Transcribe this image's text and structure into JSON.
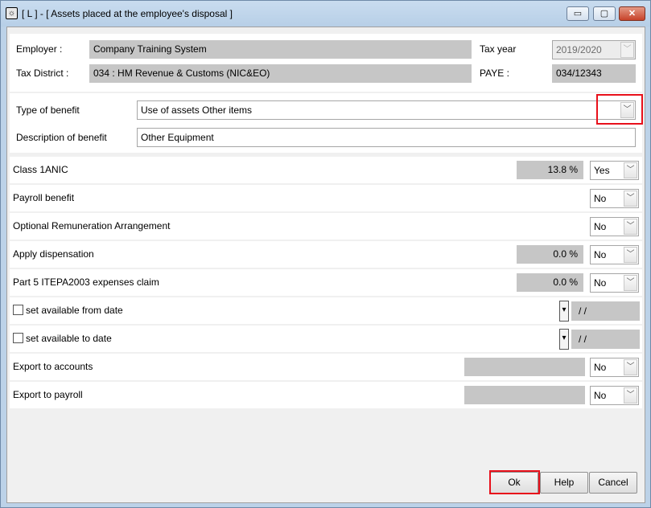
{
  "window": {
    "title": "[ L ] - [ Assets placed at the employee's disposal ]",
    "icon": "app-icon",
    "controls": {
      "minimize": "▭",
      "maximize": "▢",
      "close": "✕"
    }
  },
  "header": {
    "employer_label": "Employer :",
    "employer_value": "Company Training System",
    "tax_district_label": "Tax District :",
    "tax_district_value": "034 : HM Revenue & Customs (NIC&EO)",
    "tax_year_label": "Tax year",
    "tax_year_value": "2019/2020",
    "paye_label": "PAYE :",
    "paye_value": "034/12343"
  },
  "benefit": {
    "type_label": "Type of benefit",
    "type_value": "Use of assets Other items",
    "description_label": "Description of benefit",
    "description_value": "Other Equipment"
  },
  "rows": {
    "class1a_label": "Class 1ANIC",
    "class1a_rate": "13.8 %",
    "class1a_value": "Yes",
    "payroll_benefit_label": "Payroll benefit",
    "payroll_benefit_value": "No",
    "ora_label": "Optional Remuneration Arrangement",
    "ora_value": "No",
    "dispensation_label": "Apply dispensation",
    "dispensation_rate": "0.0 %",
    "dispensation_value": "No",
    "part5_label": "Part 5 ITEPA2003 expenses claim",
    "part5_rate": "0.0 %",
    "part5_value": "No",
    "from_date_label": "set available from date",
    "from_date_value": "/ /",
    "to_date_label": "set available to date",
    "to_date_value": "/ /",
    "export_accounts_label": "Export to accounts",
    "export_accounts_value": "No",
    "export_payroll_label": "Export to payroll",
    "export_payroll_value": "No"
  },
  "buttons": {
    "ok": "Ok",
    "help": "Help",
    "cancel": "Cancel"
  },
  "highlight_color": "#e8101b"
}
